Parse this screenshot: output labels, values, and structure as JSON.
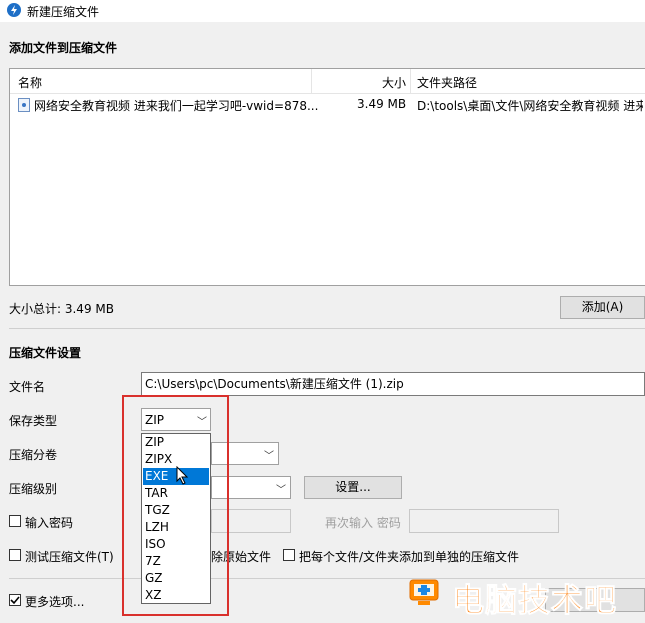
{
  "window": {
    "title": "新建压缩文件"
  },
  "add_section": {
    "title": "添加文件到压缩文件",
    "columns": [
      "名称",
      "大小",
      "文件夹路径"
    ],
    "rows": [
      {
        "name": "网络安全教育视频 进来我们一起学习吧-vwid=878...",
        "size": "3.49 MB",
        "path": "D:\\tools\\桌面\\文件\\网络安全教育视频 进来"
      }
    ],
    "total_label": "大小总计: 3.49 MB",
    "add_button": "添加(A)"
  },
  "settings": {
    "title": "压缩文件设置",
    "filename_label": "文件名",
    "filename_value": "C:\\Users\\pc\\Documents\\新建压缩文件 (1).zip",
    "save_type_label": "保存类型",
    "save_type_value": "ZIP",
    "split_label": "压缩分卷",
    "level_label": "压缩级别",
    "settings_button": "设置...",
    "password_label": "输入密码",
    "repeat_password_label": "再次输入 密码",
    "test_label": "测试压缩文件(T)",
    "delete_label": "除原始文件",
    "each_file_label": "把每个文件/文件夹添加到单独的压缩文件",
    "more_options_label": "更多选项...",
    "dropdown_options": [
      "ZIP",
      "ZIPX",
      "EXE",
      "TAR",
      "TGZ",
      "LZH",
      "ISO",
      "7Z",
      "GZ",
      "XZ"
    ],
    "highlighted_option": "EXE"
  },
  "watermark": {
    "text": "电脑技术吧"
  },
  "colors": {
    "accent": "#0078d7",
    "highlight_box": "#d9302c"
  }
}
